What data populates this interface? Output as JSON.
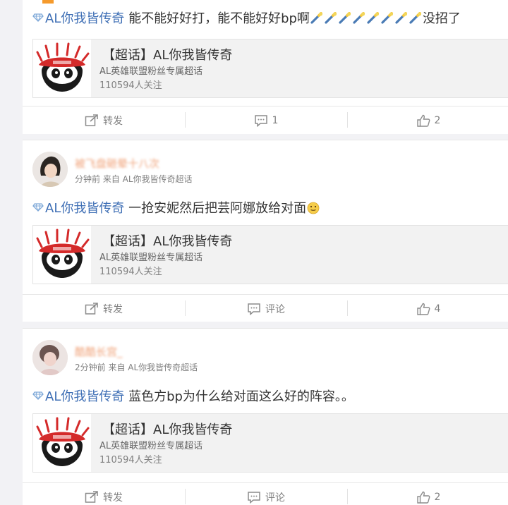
{
  "posts": [
    {
      "topic_link": "AL你我皆传奇",
      "text": "能不能好好打，能不能好好bp啊",
      "emoji_count": 8,
      "text_after_emoji": "没招了",
      "topic_card": {
        "title": "【超话】AL你我皆传奇",
        "subtitle": "AL英雄联盟粉丝专属超话",
        "followers": "110594人关注"
      },
      "actions": {
        "repost": "转发",
        "comment": "1",
        "like": "2"
      }
    },
    {
      "username": "被飞盘砸晕十八次",
      "meta": "分钟前 来自 AL你我皆传奇超话",
      "topic_link": "AL你我皆传奇",
      "text": "一抢安妮然后把芸阿娜放给对面",
      "topic_card": {
        "title": "【超话】AL你我皆传奇",
        "subtitle": "AL英雄联盟粉丝专属超话",
        "followers": "110594人关注"
      },
      "actions": {
        "repost": "转发",
        "comment": "评论",
        "like": "4"
      }
    },
    {
      "username": "酷酷长宫_",
      "meta": "2分钟前 来自 AL你我皆传奇超话",
      "topic_link": "AL你我皆传奇",
      "text": "蓝色方bp为什么给对面这么好的阵容。。",
      "topic_card": {
        "title": "【超话】AL你我皆传奇",
        "subtitle": "AL英雄联盟粉丝专属超话",
        "followers": "110594人关注"
      },
      "actions": {
        "repost": "转发",
        "comment": "评论",
        "like": "2"
      }
    }
  ],
  "icons": {
    "topic_link": "diamond-icon",
    "repost": "share-square-icon",
    "comment": "speech-bubble-icon",
    "like": "thumbs-up-icon",
    "topic_thumb": "panda-sushi-logo-icon"
  },
  "colors": {
    "link": "#3f6fb5",
    "username_orange": "#f0a37a",
    "muted": "#808080"
  }
}
